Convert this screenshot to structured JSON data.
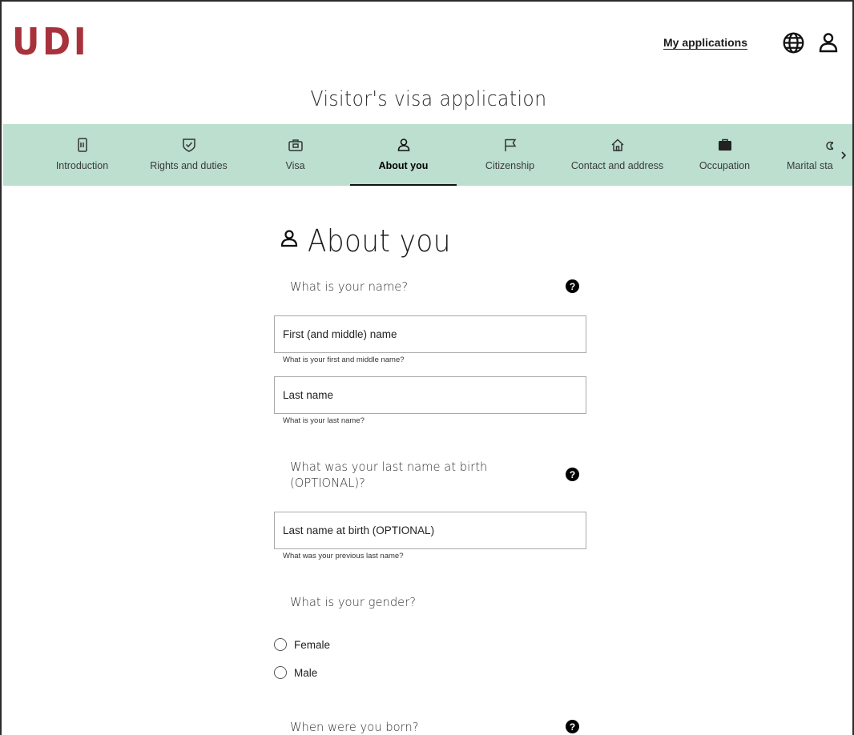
{
  "header": {
    "logo_text": "UDI",
    "my_applications": "My applications",
    "globe_icon": "globe-icon",
    "user_icon": "user-icon",
    "brand_color": "#a8323c"
  },
  "page_title": "Visitor's visa application",
  "stepper": {
    "background": "#bcdfcf",
    "steps": [
      {
        "label": "Introduction",
        "icon": "mobile-document-icon"
      },
      {
        "label": "Rights and duties",
        "icon": "shield-check-icon"
      },
      {
        "label": "Visa",
        "icon": "briefcase-passport-icon"
      },
      {
        "label": "About you",
        "icon": "person-icon",
        "active": true
      },
      {
        "label": "Citizenship",
        "icon": "flag-icon"
      },
      {
        "label": "Contact and address",
        "icon": "house-icon"
      },
      {
        "label": "Occupation",
        "icon": "suitcase-icon"
      },
      {
        "label": "Marital sta",
        "icon": "rings-icon"
      }
    ],
    "next_icon": "chevron-right-icon"
  },
  "main": {
    "section_title": "About you",
    "name_question": "What is your name?",
    "first_name": {
      "placeholder": "First (and middle) name",
      "hint": "What is your first and middle name?"
    },
    "last_name": {
      "placeholder": "Last name",
      "hint": "What is your last name?"
    },
    "birth_name_question": "What was your last name at birth (OPTIONAL)?",
    "birth_name": {
      "placeholder": "Last name at birth (OPTIONAL)",
      "hint": "What was your previous last name?"
    },
    "gender_question": "What is your gender?",
    "gender_options": [
      "Female",
      "Male"
    ],
    "born_question": "When were you born?",
    "help_symbol": "?"
  }
}
